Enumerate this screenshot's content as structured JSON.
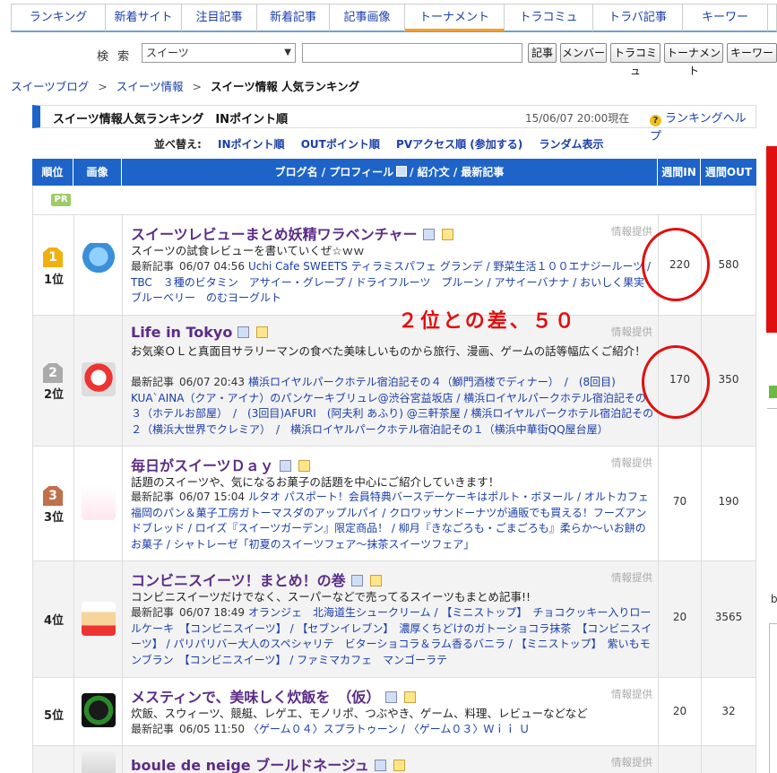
{
  "topnav": {
    "tabs": [
      {
        "label": "ランキング",
        "w": 105
      },
      {
        "label": "新着サイト",
        "w": 85
      },
      {
        "label": "注目記事",
        "w": 84
      },
      {
        "label": "新着記事",
        "w": 81
      },
      {
        "label": "記事画像",
        "w": 84
      },
      {
        "label": "トーナメント",
        "w": 111
      },
      {
        "label": "トラコミュ",
        "w": 99
      },
      {
        "label": "トラバ記事",
        "w": 100
      },
      {
        "label": "キーワー",
        "w": 95
      }
    ]
  },
  "search": {
    "label": "検 索",
    "category": "スイーツ",
    "input_value": "",
    "buttons": [
      "記事",
      "メンバー",
      "トラコミュ",
      "トーナメント",
      "キーワー"
    ]
  },
  "breadcrumb": {
    "items": [
      "スイーツブログ",
      "スイーツ情報"
    ],
    "current": "スイーツ情報 人気ランキング",
    "separator": ">"
  },
  "header": {
    "title": "スイーツ情報人気ランキング　INポイント順",
    "date": "15/06/07 20:00現在",
    "help": "ランキングヘルプ"
  },
  "sort": {
    "label": "並べ替え:",
    "options": [
      "INポイント順",
      "OUTポイント順",
      "PVアクセス順 (参加する)",
      "ランダム表示"
    ]
  },
  "table": {
    "headers": {
      "rank": "順位",
      "image": "画像",
      "main": "ブログ名 / プロフィール",
      "main_suffix": "/ 紹介文 / 最新記事",
      "in": "週間IN",
      "out": "週間OUT"
    },
    "pr": "PR",
    "info_label": "情報提供",
    "latest_label": "最新記事"
  },
  "rows": [
    {
      "rank": "1位",
      "medal": "1",
      "title": "スイーツレビューまとめ妖精ワラベンチャー",
      "intro": "スイーツの試食レビューを書いていくぜ☆ｗｗ",
      "time": "06/07 04:56",
      "articles": "Uchi Cafe SWEETS ティラミスパフェ グランデ / 野菜生活１００エナジールーツ / TBC　３種のビタミン　アサイー・グレープ / ドライフルーツ　プルーン / アサイーバナナ / おいしく果実　ブルーベリー　のむヨーグルト",
      "in": "220",
      "out": "580"
    },
    {
      "rank": "2位",
      "medal": "2",
      "title": "Life in Tokyo",
      "intro": "お気楽ＯＬと真面目サラリーマンの食べた美味しいものから旅行、漫画、ゲームの話等幅広くご紹介！",
      "time": "06/07 20:43",
      "articles": "横浜ロイヤルパークホテル宿泊記その４（鰤門酒楼でディナー）　/　(8回目) KUA`AINA（クア・アイナ）のパンケーキブリュレ@渋谷宮益坂店 / 横浜ロイヤルパークホテル宿泊記その３（ホテルお部屋）　/　(3回目)AFURI　(阿夫利 あふり) @三軒茶屋 / 横浜ロイヤルパークホテル宿泊記その２（横浜大世界でクレミア）　/　横浜ロイヤルパークホテル宿泊記その１（横浜中華街QQ屋台屋）",
      "in": "170",
      "out": "350"
    },
    {
      "rank": "3位",
      "medal": "3",
      "title": "毎日がスイーツＤａｙ",
      "intro": "話題のスイーツや、気になるお菓子の話題を中心にご紹介していきます！",
      "time": "06/07 15:04",
      "articles": "ルタオ パスポート！会員特典バースデーケーキはポルト・ボヌール / オルトカフェ福岡のパン＆菓子工房ガトーマスダのアップルパイ / クロワッサンドーナツが通販でも買える！フーズアンドブレッド / ロイズ『スイーツガーデン』限定商品！ / 柳月『きなごろも・ごまごろも』柔らか〜いお餅のお菓子 / シャトレーゼ「初夏のスイーツフェア〜抹茶スイーツフェア」",
      "in": "70",
      "out": "190"
    },
    {
      "rank": "4位",
      "medal": "",
      "title": "コンビニスイーツ！まとめ！の巻",
      "intro": "コンビニスイーツだけでなく、スーパーなどで売ってるスイーツもまとめ記事!!",
      "time": "06/07 18:49",
      "articles": "オランジェ　北海道生シュークリーム / 【ミニストップ】　チョコクッキー入りロールケーキ　【コンビニスイーツ】 / 【セブンイレブン】　濃厚くちどけのガトーショコラ抹茶　【コンビニスイーツ】 / パリパリバー大人のスペシャリテ　ビターショコラ＆ラム香るバニラ / 【ミニストップ】　紫いもモンブラン　【コンビニスイーツ】 / ファミマカフェ　マンゴーラテ",
      "in": "20",
      "out": "3565"
    },
    {
      "rank": "5位",
      "medal": "",
      "title": "メスティンで、美味しく炊飯を　（仮）",
      "intro": "炊飯、スウィーツ、競艇、レゲエ、モノリポ、つぶやき、ゲーム、料理、レビューなどなど",
      "time": "06/05 11:50",
      "articles": "〈ゲーム０４〉スプラトゥーン / 〈ゲーム０３〉Ｗｉｉ Ｕ",
      "in": "20",
      "out": "32"
    },
    {
      "rank": "",
      "medal": "",
      "title": "boule de neige ブールドネージュ",
      "intro": "",
      "time": "",
      "articles": "",
      "in": "",
      "out": ""
    }
  ],
  "annotation": "２位との差、５０",
  "edge": {
    "b": "b"
  },
  "colors": {
    "accent": "#1e64c8",
    "annotation": "#e01010",
    "title": "#5b2c86",
    "link": "#1a3ea8"
  }
}
